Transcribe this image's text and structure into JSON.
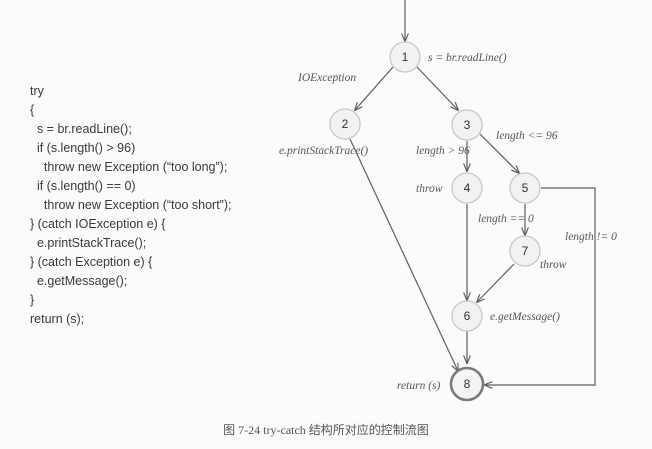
{
  "code": {
    "lines": [
      "try",
      "{",
      "  s = br.readLine();",
      "  if (s.length() > 96)",
      "    throw new Exception (“too long”);",
      "  if (s.length() == 0)",
      "    throw new Exception (“too short”);",
      "} (catch IOException e) {",
      "  e.printStackTrace();",
      "} (catch Exception e) {",
      "  e.getMessage();",
      "}",
      "return (s);"
    ]
  },
  "graph": {
    "nodes": [
      {
        "id": "1",
        "label": "1"
      },
      {
        "id": "2",
        "label": "2"
      },
      {
        "id": "3",
        "label": "3"
      },
      {
        "id": "4",
        "label": "4"
      },
      {
        "id": "5",
        "label": "5"
      },
      {
        "id": "6",
        "label": "6"
      },
      {
        "id": "7",
        "label": "7"
      },
      {
        "id": "8",
        "label": "8"
      }
    ],
    "labels": {
      "n1": "s = br.readLine()",
      "ioexception": "IOException",
      "print_stack": "e.printStackTrace()",
      "len_le_96": "length <= 96",
      "len_gt_96": "length > 96",
      "throw_4": "throw",
      "len_eq_0": "length == 0",
      "len_ne_0": "length != 0",
      "throw_7": "throw",
      "get_message": "e.getMessage()",
      "return_s": "return (s)"
    }
  },
  "caption": "图 7-24    try-catch 结构所对应的控制流图"
}
